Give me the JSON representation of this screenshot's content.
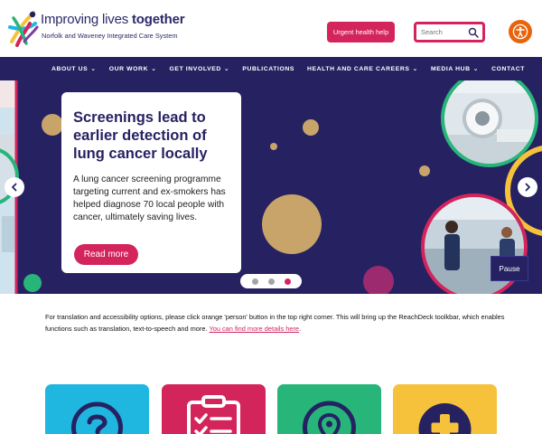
{
  "header": {
    "brand_title_regular": "Improving lives ",
    "brand_title_bold": "together",
    "brand_subtitle": "Norfolk and Waveney Integrated Care System",
    "urgent_label": "Urgent health help",
    "search_placeholder": "Search",
    "accessibility_icon": "person-icon"
  },
  "nav": {
    "items": [
      {
        "label": "ABOUT US",
        "has_dropdown": true
      },
      {
        "label": "OUR WORK",
        "has_dropdown": true
      },
      {
        "label": "GET INVOLVED",
        "has_dropdown": true
      },
      {
        "label": "PUBLICATIONS",
        "has_dropdown": false
      },
      {
        "label": "HEALTH AND CARE CAREERS",
        "has_dropdown": true
      },
      {
        "label": "MEDIA HUB",
        "has_dropdown": true
      },
      {
        "label": "CONTACT",
        "has_dropdown": false
      }
    ]
  },
  "hero": {
    "title": "Screenings lead to earlier detection of lung cancer locally",
    "body": "A lung cancer screening programme targeting current and ex-smokers has helped diagnose 70 local people with cancer, ultimately saving lives.",
    "read_more": "Read more",
    "prev_icon": "chevron-left-icon",
    "next_icon": "chevron-right-icon",
    "slide_count": 3,
    "active_slide": 3,
    "pause_label": "Pause"
  },
  "info": {
    "text": "For translation and accessibility options, please click orange 'person' button in the top right corner. This will bring up the ReachDeck toolkbar, which enables functions such as translation, text-to-speech and more. ",
    "link_text": "You can find more details here",
    "suffix": "."
  },
  "tiles": [
    {
      "icon": "question-icon",
      "color": "#1fb6e0"
    },
    {
      "icon": "clipboard-checklist-icon",
      "color": "#d4245c"
    },
    {
      "icon": "location-pin-icon",
      "color": "#27b57a"
    },
    {
      "icon": "plus-cross-icon",
      "color": "#f6c23c"
    }
  ],
  "colors": {
    "navy": "#262262",
    "accent_pink": "#d4245c",
    "accessibility_orange": "#e8640c"
  }
}
